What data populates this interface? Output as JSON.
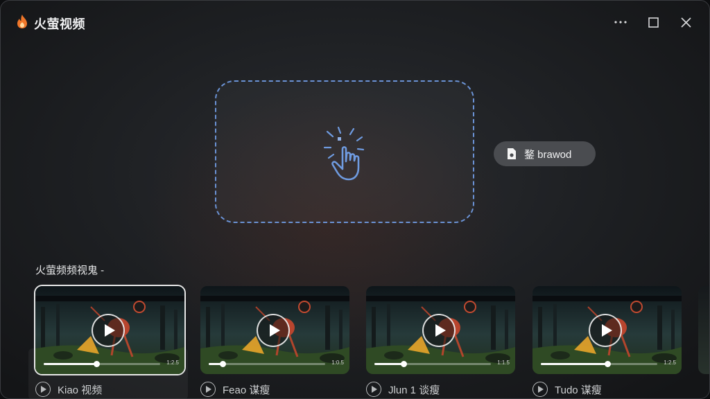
{
  "app": {
    "title": "火萤视频",
    "accent": "#f0772a"
  },
  "titlebar": {
    "more_icon": "more-icon",
    "maximize_icon": "maximize-icon",
    "close_icon": "close-icon"
  },
  "dropzone": {
    "icon": "tap-hand-icon",
    "border_color": "#6b93d6"
  },
  "side_pill": {
    "label": "鍪 brawod",
    "icon": "file-icon"
  },
  "section": {
    "label": "火萤频频视鬼 -"
  },
  "videos": [
    {
      "caption": "Kiao 视频",
      "time": "1:2.5",
      "progress": 0.45,
      "selected": true
    },
    {
      "caption": "Feao 谋瘦",
      "time": "1:0.5",
      "progress": 0.12,
      "selected": false
    },
    {
      "caption": "Jlun 1 谈瘦",
      "time": "1:1.5",
      "progress": 0.25,
      "selected": false
    },
    {
      "caption": "Tudo 谋瘦",
      "time": "1:2.5",
      "progress": 0.57,
      "selected": false
    }
  ]
}
